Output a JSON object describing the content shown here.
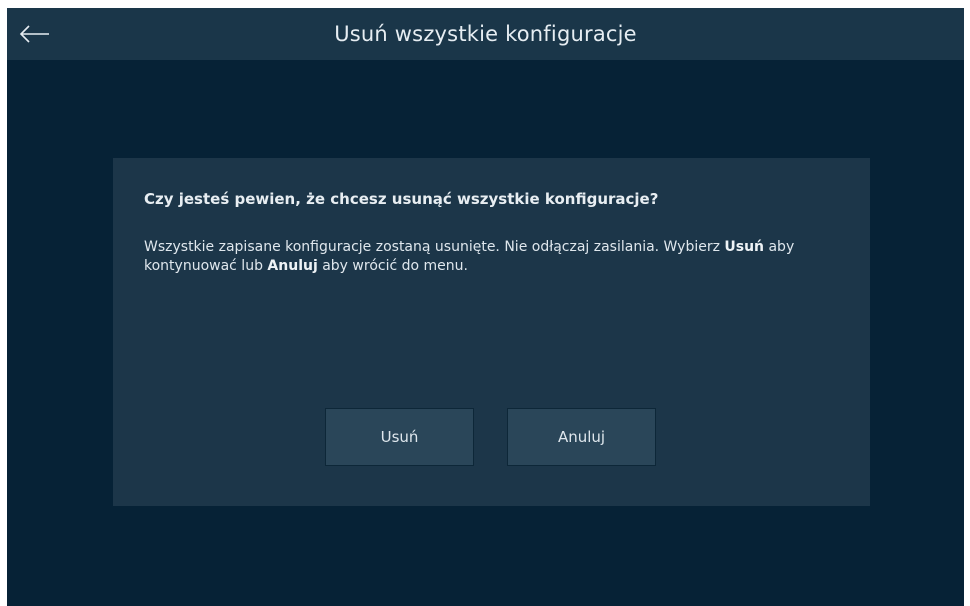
{
  "header": {
    "title": "Usuń wszystkie konfiguracje",
    "back_icon": "arrow-left-icon"
  },
  "dialog": {
    "question": "Czy jesteś pewien, że chcesz usunąć wszystkie konfiguracje?",
    "message_part1": "Wszystkie zapisane konfiguracje zostaną usunięte. Nie odłączaj zasilania. Wybierz ",
    "message_bold1": "Usuń",
    "message_part2": " aby kontynuować lub ",
    "message_bold2": "Anuluj",
    "message_part3": " aby wrócić do menu.",
    "delete_label": "Usuń",
    "cancel_label": "Anuluj"
  },
  "colors": {
    "background": "#062236",
    "header": "#1a3649",
    "dialog": "#1c3649",
    "button": "#2a4659",
    "text": "#e6edf2"
  }
}
